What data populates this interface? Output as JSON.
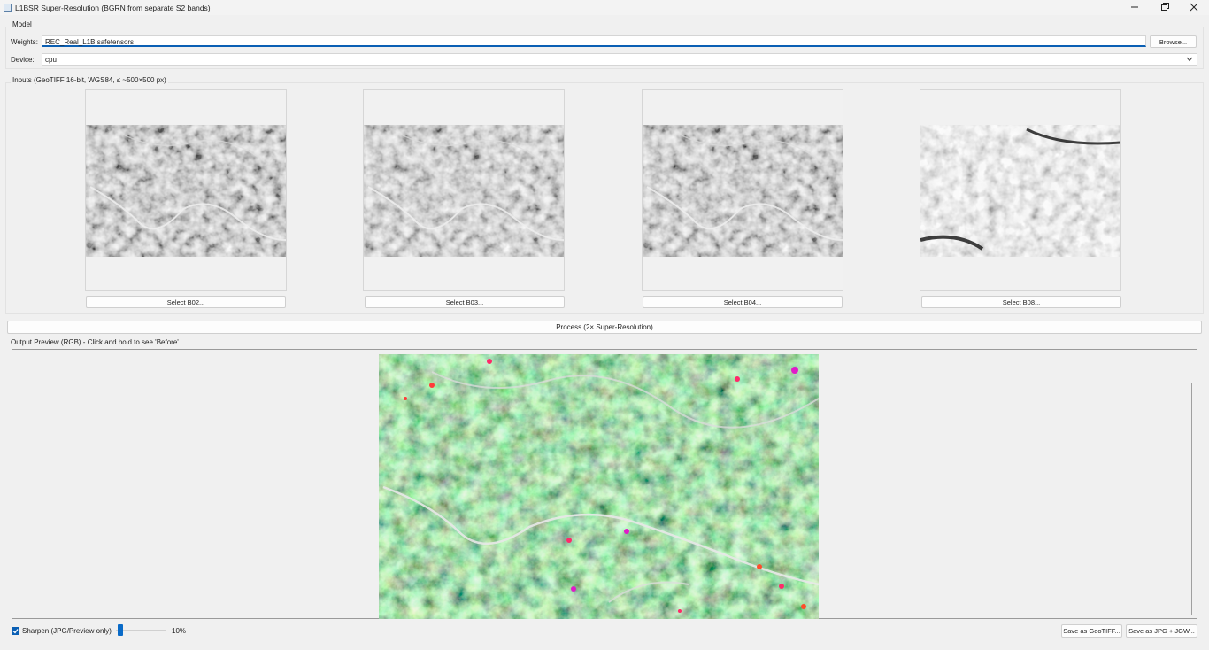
{
  "window": {
    "title": "L1BSR Super-Resolution (BGRN from separate S2 bands)",
    "minimize_icon": "minimize-icon",
    "maximize_icon": "restore-icon",
    "close_icon": "close-icon"
  },
  "model": {
    "group_label": "Model",
    "weights_label": "Weights:",
    "weights_value": "REC_Real_L1B.safetensors",
    "browse_label": "Browse...",
    "device_label": "Device:",
    "device_value": "cpu"
  },
  "inputs": {
    "group_label": "Inputs (GeoTIFF 16-bit, WGS84, ≤ ~500×500 px)",
    "bands": [
      {
        "button_label": "Select B02..."
      },
      {
        "button_label": "Select B03..."
      },
      {
        "button_label": "Select B04..."
      },
      {
        "button_label": "Select B08..."
      }
    ]
  },
  "process": {
    "button_label": "Process (2× Super-Resolution)"
  },
  "output": {
    "group_label": "Output Preview (RGB) - Click and hold to see 'Before'",
    "sharpen_label": "Sharpen (JPG/Preview only)",
    "sharpen_checked": true,
    "sharpen_level": 10,
    "sharpen_value_label": "10%",
    "save_geotiff_label": "Save as GeoTIFF...",
    "save_jpg_label": "Save as JPG + JGW..."
  },
  "colors": {
    "accent": "#0a5fb4",
    "window_bg": "#f0f0f0"
  }
}
